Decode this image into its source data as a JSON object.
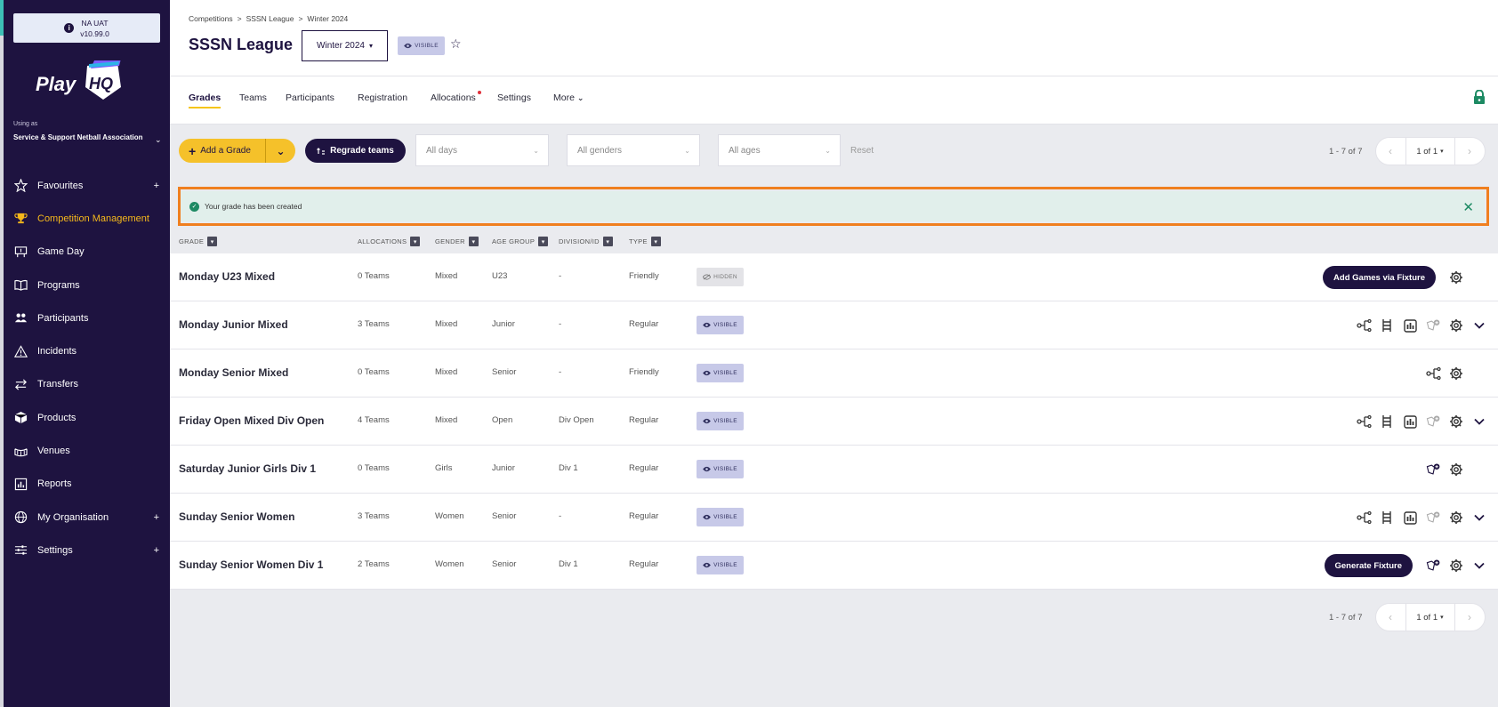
{
  "env": {
    "line1": "NA UAT",
    "line2": "v10.99.0"
  },
  "sidebar": {
    "using_as": "Using as",
    "org": "Service & Support Netball Association",
    "items": [
      {
        "label": "Favourites",
        "icon": "star-icon",
        "plus": "+"
      },
      {
        "label": "Competition Management",
        "icon": "trophy-icon",
        "plus": ""
      },
      {
        "label": "Game Day",
        "icon": "scoreboard-icon",
        "plus": ""
      },
      {
        "label": "Programs",
        "icon": "book-icon",
        "plus": ""
      },
      {
        "label": "Participants",
        "icon": "people-icon",
        "plus": ""
      },
      {
        "label": "Incidents",
        "icon": "warning-icon",
        "plus": ""
      },
      {
        "label": "Transfers",
        "icon": "transfer-icon",
        "plus": ""
      },
      {
        "label": "Products",
        "icon": "box-icon",
        "plus": ""
      },
      {
        "label": "Venues",
        "icon": "stadium-icon",
        "plus": ""
      },
      {
        "label": "Reports",
        "icon": "report-icon",
        "plus": ""
      },
      {
        "label": "My Organisation",
        "icon": "globe-icon",
        "plus": "+"
      },
      {
        "label": "Settings",
        "icon": "sliders-icon",
        "plus": "+"
      }
    ]
  },
  "breadcrumb": {
    "c1": "Competitions",
    "c2": "SSSN League",
    "c3": "Winter 2024",
    "sep": ">"
  },
  "header": {
    "title": "SSSN League",
    "season": "Winter 2024",
    "visibility": "VISIBLE"
  },
  "tabs": [
    {
      "label": "Grades"
    },
    {
      "label": "Teams"
    },
    {
      "label": "Participants"
    },
    {
      "label": "Registration"
    },
    {
      "label": "Allocations"
    },
    {
      "label": "Settings"
    },
    {
      "label": "More"
    }
  ],
  "toolbar": {
    "add_grade": "Add a Grade",
    "regrade": "Regrade teams",
    "filters": {
      "days": "All days",
      "genders": "All genders",
      "ages": "All ages"
    },
    "reset": "Reset"
  },
  "pager": {
    "count": "1 - 7 of 7",
    "page": "1 of 1"
  },
  "alert": {
    "message": "Your grade has been created"
  },
  "columns": {
    "grade": "GRADE",
    "allocations": "ALLOCATIONS",
    "gender": "GENDER",
    "age_group": "AGE GROUP",
    "division": "DIVISION/ID",
    "type": "TYPE"
  },
  "grades": [
    {
      "name": "Monday U23 Mixed",
      "allocations": "0 Teams",
      "gender": "Mixed",
      "age": "U23",
      "division": "-",
      "type": "Friendly",
      "status": "HIDDEN",
      "button": "Add Games via Fixture"
    },
    {
      "name": "Monday Junior Mixed",
      "allocations": "3 Teams",
      "gender": "Mixed",
      "age": "Junior",
      "division": "-",
      "type": "Regular",
      "status": "VISIBLE",
      "button": ""
    },
    {
      "name": "Monday Senior Mixed",
      "allocations": "0 Teams",
      "gender": "Mixed",
      "age": "Senior",
      "division": "-",
      "type": "Friendly",
      "status": "VISIBLE",
      "button": ""
    },
    {
      "name": "Friday Open Mixed Div Open",
      "allocations": "4 Teams",
      "gender": "Mixed",
      "age": "Open",
      "division": "Div Open",
      "type": "Regular",
      "status": "VISIBLE",
      "button": ""
    },
    {
      "name": "Saturday Junior Girls Div 1",
      "allocations": "0 Teams",
      "gender": "Girls",
      "age": "Junior",
      "division": "Div 1",
      "type": "Regular",
      "status": "VISIBLE",
      "button": ""
    },
    {
      "name": "Sunday Senior Women",
      "allocations": "3 Teams",
      "gender": "Women",
      "age": "Senior",
      "division": "-",
      "type": "Regular",
      "status": "VISIBLE",
      "button": ""
    },
    {
      "name": "Sunday Senior Women Div 1",
      "allocations": "2 Teams",
      "gender": "Women",
      "age": "Senior",
      "division": "Div 1",
      "type": "Regular",
      "status": "VISIBLE",
      "button": "Generate Fixture"
    }
  ],
  "colors": {
    "brand_dark": "#1e1340",
    "accent_yellow": "#f5c12a",
    "success_green": "#1d8a63",
    "highlight_orange": "#f07f1f"
  }
}
